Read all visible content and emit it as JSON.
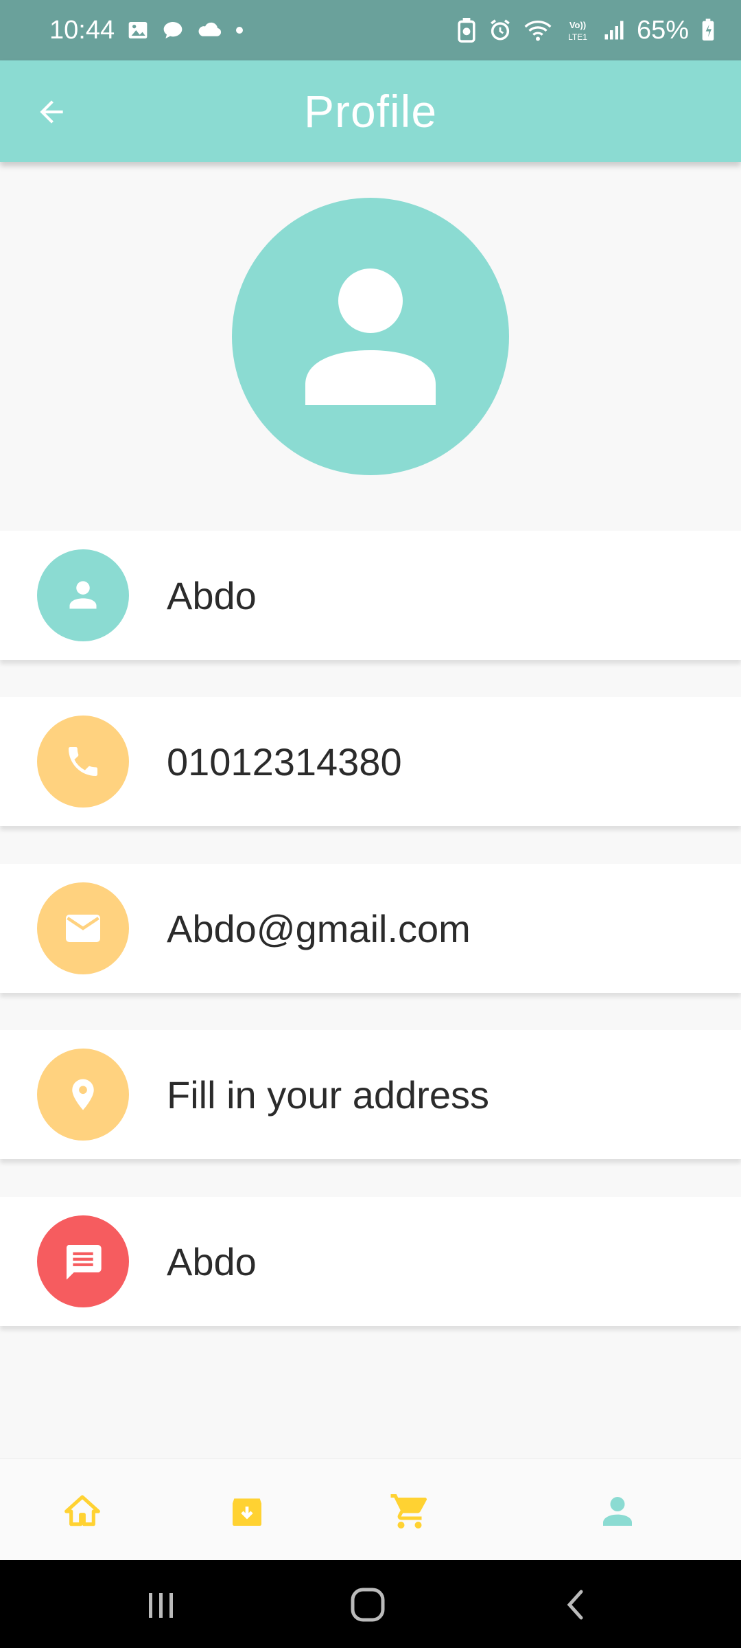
{
  "status_bar": {
    "time": "10:44",
    "battery": "65%",
    "icons_left": [
      "gallery-icon",
      "chat-bubble-icon",
      "cloud-icon",
      "dot-icon"
    ],
    "icons_right": [
      "battery-saver-icon",
      "alarm-icon",
      "wifi-icon",
      "volte-icon",
      "signal-icon",
      "battery-icon"
    ],
    "volte_label": "Vo)) LTE1"
  },
  "app_bar": {
    "title": "Profile",
    "back_icon": "arrow-back-icon"
  },
  "colors": {
    "primary": "#8bdbd2",
    "status_bar": "#6aa19b",
    "accent_yellow": "#ffd27f",
    "accent_red": "#f65c5f",
    "nav_yellow": "#ffd232",
    "text": "#2b2b2b"
  },
  "profile": {
    "avatar_icon": "person-icon",
    "items": [
      {
        "icon": "person-icon",
        "value": "Abdo",
        "color": "#8bdbd2"
      },
      {
        "icon": "phone-icon",
        "value": "01012314380",
        "color": "#ffd27f"
      },
      {
        "icon": "email-icon",
        "value": "Abdo@gmail.com",
        "color": "#ffd27f"
      },
      {
        "icon": "location-pin-icon",
        "value": "Fill in your address",
        "color": "#ffd27f"
      },
      {
        "icon": "message-icon",
        "value": "Abdo",
        "color": "#f65c5f"
      }
    ]
  },
  "bottom_nav": {
    "items": [
      {
        "icon": "home-icon",
        "active": false
      },
      {
        "icon": "archive-download-icon",
        "active": false
      },
      {
        "icon": "cart-icon",
        "active": false
      },
      {
        "icon": "person-icon",
        "active": true
      }
    ]
  },
  "system_nav": {
    "items": [
      "recents-icon",
      "home-circle-icon",
      "back-chevron-icon"
    ]
  }
}
